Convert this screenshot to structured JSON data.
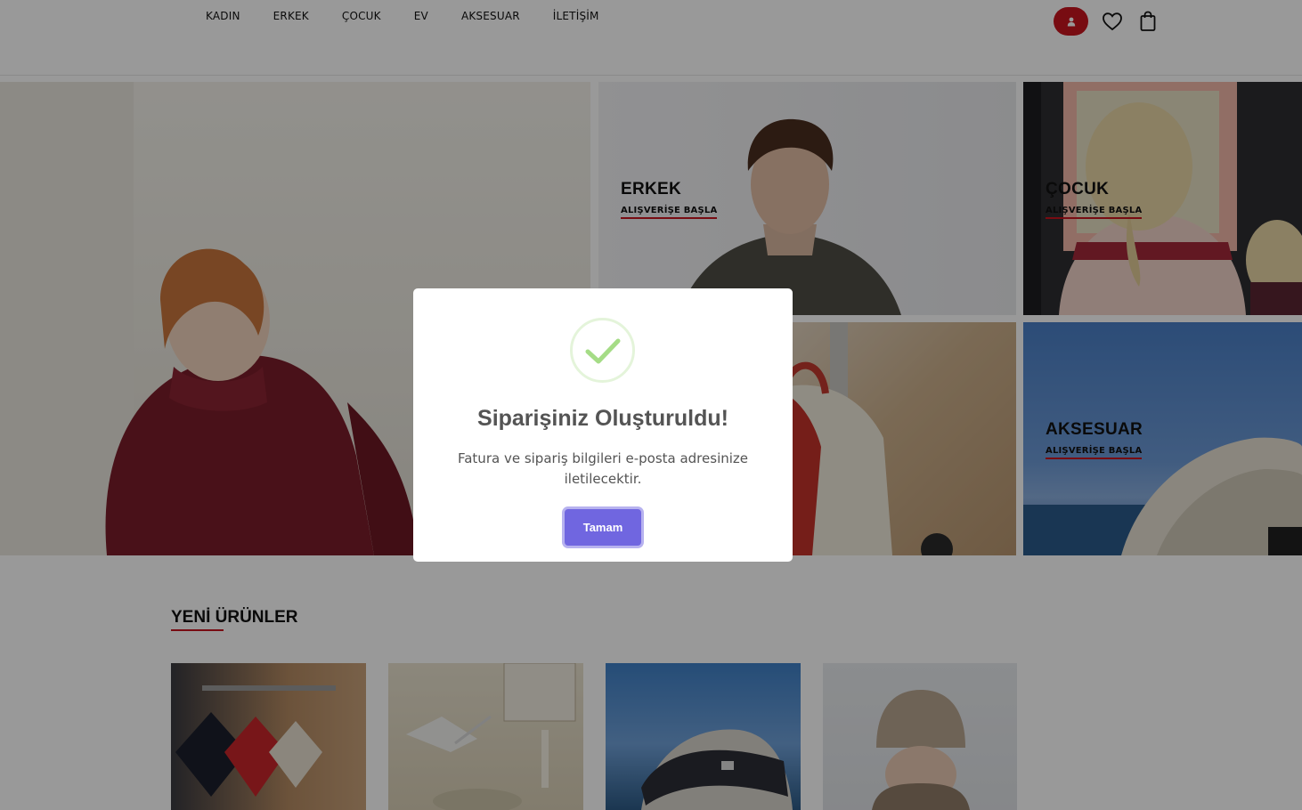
{
  "nav": {
    "items": [
      {
        "label": "KADIN"
      },
      {
        "label": "ERKEK"
      },
      {
        "label": "ÇOCUK"
      },
      {
        "label": "EV"
      },
      {
        "label": "AKSESUAR"
      },
      {
        "label": "İLETİŞİM"
      }
    ]
  },
  "header_icons": {
    "account": "user-icon",
    "wishlist": "heart-icon",
    "cart": "shopping-bag-icon"
  },
  "hero": {
    "tiles": [
      {
        "title": "",
        "cta": ""
      },
      {
        "title": "ERKEK",
        "cta": "ALIŞVERİŞE BAŞLA"
      },
      {
        "title": "ÇOCUK",
        "cta": "ALIŞVERİŞE BAŞLA"
      },
      {
        "title": "",
        "cta": ""
      },
      {
        "title": "AKSESUAR",
        "cta": "ALIŞVERİŞE BAŞLA"
      }
    ]
  },
  "new_products": {
    "title": "YENİ ÜRÜNLER"
  },
  "modal": {
    "title": "Siparişiniz Oluşturuldu!",
    "text": "Fatura ve sipariş bilgileri e-posta adresinize iletilecektir.",
    "button": "Tamam"
  },
  "colors": {
    "accent": "#c8141f",
    "button": "#7066e0",
    "success": "#a5dc86"
  }
}
